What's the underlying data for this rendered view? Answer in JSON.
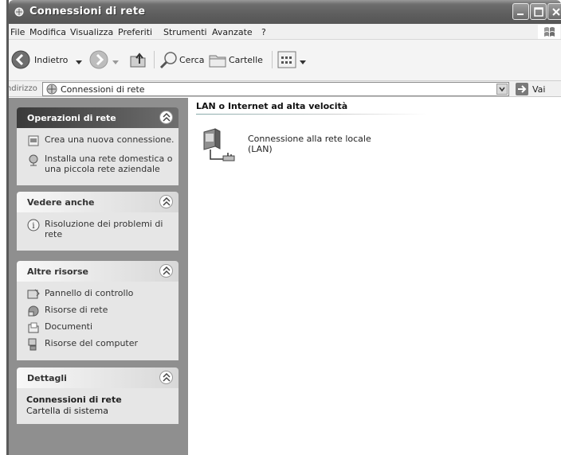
{
  "window": {
    "title": "Connessioni di rete"
  },
  "menubar": {
    "items": [
      "File",
      "Modifica",
      "Visualizza",
      "Preferiti",
      "Strumenti",
      "Avanzate",
      "?"
    ]
  },
  "toolbar": {
    "back_label": "Indietro",
    "search_label": "Cerca",
    "folders_label": "Cartelle"
  },
  "address": {
    "label": "Indirizzo",
    "value": "Connessioni di rete",
    "go_label": "Vai"
  },
  "sidebar": {
    "panels": [
      {
        "title": "Operazioni di rete",
        "tasks": [
          {
            "label": "Crea una nuova connessione.",
            "icon": "new-connection-icon"
          },
          {
            "label": "Installa una rete domestica o una piccola rete aziendale",
            "icon": "home-network-icon"
          }
        ]
      },
      {
        "title": "Vedere anche",
        "tasks": [
          {
            "label": "Risoluzione dei problemi di rete",
            "icon": "help-icon"
          }
        ]
      },
      {
        "title": "Altre risorse",
        "tasks": [
          {
            "label": "Pannello di controllo",
            "icon": "control-panel-icon"
          },
          {
            "label": "Risorse di rete",
            "icon": "network-places-icon"
          },
          {
            "label": "Documenti",
            "icon": "documents-icon"
          },
          {
            "label": "Risorse del computer",
            "icon": "my-computer-icon"
          }
        ]
      },
      {
        "title": "Dettagli",
        "detail_name": "Connessioni di rete",
        "detail_sub": "Cartella di sistema"
      }
    ]
  },
  "content": {
    "group_title": "LAN o Internet ad alta velocità",
    "items": [
      {
        "label_line1": "Connessione alla rete locale",
        "label_line2": "(LAN)",
        "icon": "lan-connection-icon"
      }
    ]
  }
}
